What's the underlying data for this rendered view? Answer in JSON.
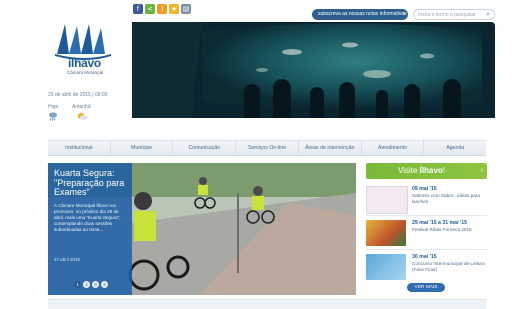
{
  "header": {
    "newsletter_label": "subscreva as nossas notas informativas",
    "search_placeholder": "Insira o termo a pesquisar"
  },
  "brand": {
    "name": "ílhavo",
    "sub": "Câmara Municipal"
  },
  "date": "29 de abril de 2015 | 09:09",
  "weather": {
    "today": "Hoje",
    "tomorrow": "Amanhã"
  },
  "nav": {
    "items": [
      "Institucional",
      "Munícipe",
      "Comunicação",
      "Serviços On-line",
      "Áreas de Intervenção",
      "Atendimento",
      "Agenda"
    ]
  },
  "feature": {
    "title": "Kuarta Segura: \"Preparação para Exames\"",
    "body": "A Câmara Municipal Ílhavo vai promover, no próximo dia 29 de abril, mais uma \"Kuarta Segura\", contemplando duas sessões subordinadas ao tema...",
    "date": "27 abril 2015",
    "slides": [
      "1",
      "2",
      "3",
      "4"
    ]
  },
  "sidebar": {
    "visit_prefix": "Visite",
    "visit_brand": "Ílhavo",
    "visit_suffix": "!",
    "events": [
      {
        "date": "09 mai '15",
        "text": "Sabores com Sabor...idéias para lanches"
      },
      {
        "date": "29 mai '15 a 31 mai '15",
        "text": "Festival Ribás Forneca 2015"
      },
      {
        "date": "30 mai '15",
        "text": "Concurso Intermunicipal de Leitura (Fase Final)"
      }
    ],
    "see_more": "VER MAIS"
  },
  "social": {
    "icons": [
      "facebook-icon",
      "share-icon",
      "rss-icon",
      "star-icon",
      "print-icon"
    ],
    "colors": [
      "#3b5998",
      "#6cb33f",
      "#f39a1e",
      "#f2b320",
      "#7a8fa3"
    ]
  }
}
